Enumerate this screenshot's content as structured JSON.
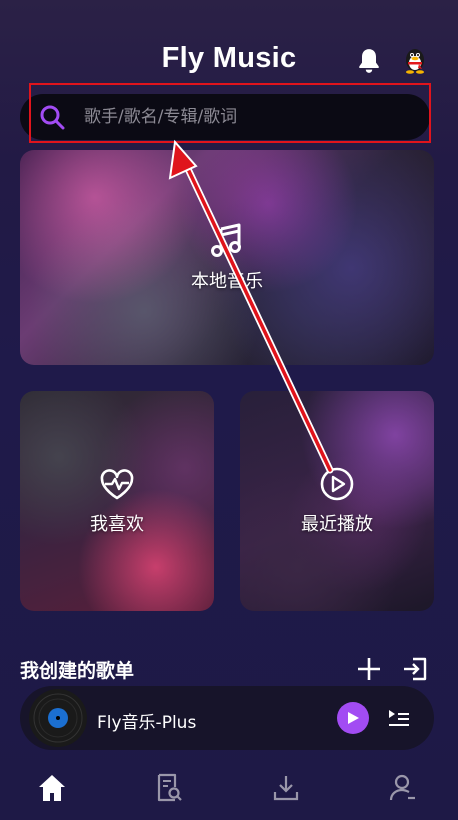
{
  "header": {
    "title": "Fly Music"
  },
  "search": {
    "placeholder": "歌手/歌名/专辑/歌词",
    "value": ""
  },
  "cards": {
    "local": "本地音乐",
    "favorite": "我喜欢",
    "recent": "最近播放"
  },
  "playlists": {
    "title": "我创建的歌单"
  },
  "player": {
    "track": "Fly音乐-Plus"
  },
  "colors": {
    "accent": "#a24cf3",
    "highlight": "#e0141c",
    "background": "#1f1a4a"
  },
  "icons": {
    "bell": "bell-icon",
    "qq": "qq-penguin-icon",
    "search": "search-icon",
    "music": "music-note-icon",
    "heart": "heart-pulse-icon",
    "play": "play-circle-icon",
    "add": "plus-icon",
    "import": "import-icon",
    "queue": "playlist-queue-icon",
    "home": "home-icon",
    "discover": "discover-icon",
    "download": "download-icon",
    "profile": "profile-icon"
  },
  "nav": [
    "home",
    "discover",
    "download",
    "profile"
  ]
}
